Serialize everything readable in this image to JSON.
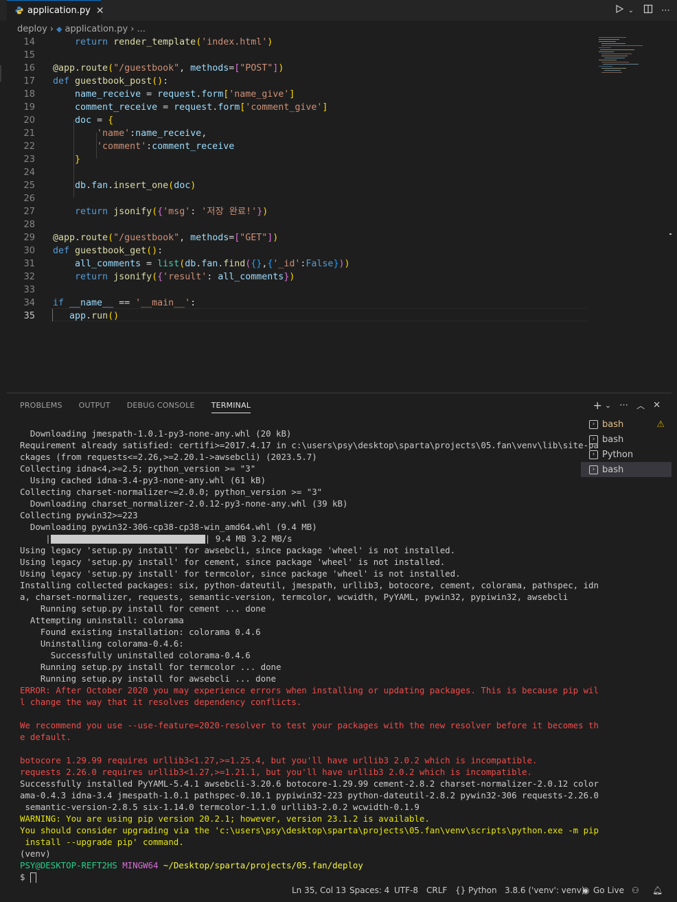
{
  "tab": {
    "label": "application.py",
    "icon": "python-icon"
  },
  "breadcrumb": {
    "folder": "deploy",
    "file": "application.py",
    "more": "..."
  },
  "editor": {
    "line_numbers": [
      "14",
      "15",
      "16",
      "17",
      "18",
      "19",
      "20",
      "21",
      "22",
      "23",
      "24",
      "25",
      "26",
      "27",
      "28",
      "29",
      "30",
      "31",
      "32",
      "33",
      "34",
      "35"
    ],
    "current_line": "35"
  },
  "panel": {
    "tabs": [
      "PROBLEMS",
      "OUTPUT",
      "DEBUG CONSOLE",
      "TERMINAL"
    ],
    "active_tab": "TERMINAL",
    "terminals": [
      "bash",
      "bash",
      "Python",
      "bash"
    ],
    "selected_terminal_index": 3,
    "progress": {
      "label": "9.4 MB 3.2 MB/s",
      "fraction": 1.0
    }
  },
  "terminal_lines": [
    "  Downloading jmespath-1.0.1-py3-none-any.whl (20 kB)",
    "Requirement already satisfied: certifi>=2017.4.17 in c:\\users\\psy\\desktop\\sparta\\projects\\05.fan\\venv\\lib\\site-pa",
    "ckages (from requests<=2.26,>=2.20.1->awsebcli) (2023.5.7)",
    "Collecting idna<4,>=2.5; python_version >= \"3\"",
    "  Using cached idna-3.4-py3-none-any.whl (61 kB)",
    "Collecting charset-normalizer~=2.0.0; python_version >= \"3\"",
    "  Downloading charset_normalizer-2.0.12-py3-none-any.whl (39 kB)",
    "Collecting pywin32>=223",
    "  Downloading pywin32-306-cp38-cp38-win_amd64.whl (9.4 MB)"
  ],
  "terminal_lines_b": [
    "Using legacy 'setup.py install' for awsebcli, since package 'wheel' is not installed.",
    "Using legacy 'setup.py install' for cement, since package 'wheel' is not installed.",
    "Using legacy 'setup.py install' for termcolor, since package 'wheel' is not installed.",
    "Installing collected packages: six, python-dateutil, jmespath, urllib3, botocore, cement, colorama, pathspec, idn",
    "a, charset-normalizer, requests, semantic-version, termcolor, wcwidth, PyYAML, pywin32, pypiwin32, awsebcli",
    "    Running setup.py install for cement ... done",
    "  Attempting uninstall: colorama",
    "    Found existing installation: colorama 0.4.6",
    "    Uninstalling colorama-0.4.6:",
    "      Successfully uninstalled colorama-0.4.6",
    "    Running setup.py install for termcolor ... done",
    "    Running setup.py install for awsebcli ... done"
  ],
  "terminal_errors": [
    "ERROR: After October 2020 you may experience errors when installing or updating packages. This is because pip wil",
    "l change the way that it resolves dependency conflicts.",
    "",
    "We recommend you use --use-feature=2020-resolver to test your packages with the new resolver before it becomes th",
    "e default.",
    "",
    "botocore 1.29.99 requires urllib3<1.27,>=1.25.4, but you'll have urllib3 2.0.2 which is incompatible.",
    "requests 2.26.0 requires urllib3<1.27,>=1.21.1, but you'll have urllib3 2.0.2 which is incompatible."
  ],
  "terminal_success": [
    "Successfully installed PyYAML-5.4.1 awsebcli-3.20.6 botocore-1.29.99 cement-2.8.2 charset-normalizer-2.0.12 color",
    "ama-0.4.3 idna-3.4 jmespath-1.0.1 pathspec-0.10.1 pypiwin32-223 python-dateutil-2.8.2 pywin32-306 requests-2.26.0",
    " semantic-version-2.8.5 six-1.14.0 termcolor-1.1.0 urllib3-2.0.2 wcwidth-0.1.9"
  ],
  "terminal_warnings": [
    "WARNING: You are using pip version 20.2.1; however, version 23.1.2 is available.",
    "You should consider upgrading via the 'c:\\users\\psy\\desktop\\sparta\\projects\\05.fan\\venv\\scripts\\python.exe -m pip",
    " install --upgrade pip' command."
  ],
  "prompt": {
    "venv": "(venv)",
    "user_host": "PSY@DESKTOP-REFT2HS",
    "shell": "MINGW64",
    "path": "~/Desktop/sparta/projects/05.fan/deploy",
    "symbol": "$"
  },
  "status": {
    "position": "Ln 35, Col 13",
    "spaces": "Spaces: 4",
    "encoding": "UTF-8",
    "eol": "CRLF",
    "language": "Python",
    "interpreter": "3.8.6 ('venv': venv)",
    "golive": "Go Live"
  },
  "colors": {
    "accent": "#0078d4",
    "error": "#f14c4c",
    "warning": "#e5e510",
    "prompt_user": "#23d18b",
    "prompt_shell": "#d670d6"
  }
}
